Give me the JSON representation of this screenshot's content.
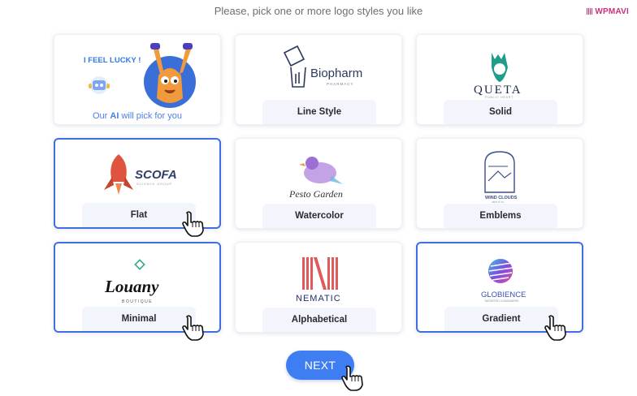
{
  "header": {
    "prompt": "Please, pick one or more logo styles you like"
  },
  "watermark": {
    "text": "WPMAVI",
    "color": "#c8307a"
  },
  "lucky": {
    "title": "I FEEL LUCKY !",
    "subtitle_prefix": "Our ",
    "subtitle_ai": "AI",
    "subtitle_suffix": " will pick for you"
  },
  "cards": [
    {
      "label": "Line Style",
      "logo_text": "Biopharm",
      "logo_sub": "PHARMACY",
      "selected": false
    },
    {
      "label": "Solid",
      "logo_text": "QUETA",
      "logo_sub": "PUBLIC HEART",
      "selected": false
    },
    {
      "label": "Flat",
      "logo_text": "SCOFA",
      "logo_sub": "SCIENCE GROUP",
      "selected": true
    },
    {
      "label": "Watercolor",
      "logo_text": "Pesto Garden",
      "selected": false
    },
    {
      "label": "Emblems",
      "logo_text": "WIND CLOUDS",
      "logo_sub": "ABOUT US",
      "selected": false
    },
    {
      "label": "Minimal",
      "logo_text": "Louany",
      "logo_sub": "BOUTIQUE",
      "selected": true
    },
    {
      "label": "Alphabetical",
      "logo_text": "NEMATIC",
      "selected": false
    },
    {
      "label": "Gradient",
      "logo_text": "GLOBIENCE",
      "logo_sub": "TARGETED CONSUMERS",
      "selected": true
    }
  ],
  "next_button": {
    "label": "NEXT"
  },
  "colors": {
    "accent": "#3f7ef2",
    "selected_border": "#3d6fe0",
    "pill_bg": "#f2f5fb"
  }
}
